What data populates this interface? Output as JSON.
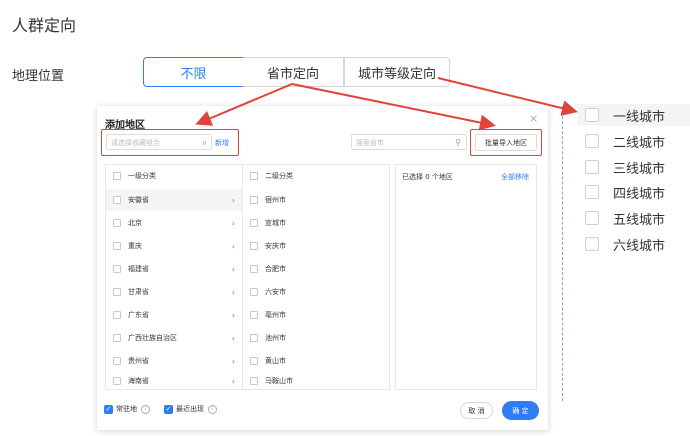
{
  "header": {
    "title": "人群定向"
  },
  "geo": {
    "label": "地理位置",
    "options": [
      "不限",
      "省市定向",
      "城市等级定向"
    ]
  },
  "modal": {
    "title": "添加地区",
    "close": "×",
    "select_placeholder": "请选择收藏组合",
    "add_link": "新增",
    "search_placeholder": "搜索省市",
    "import_button": "批量导入地区",
    "left_header": "一级分类",
    "mid_header": "二级分类",
    "right_header": "已选择 0 个地区",
    "clear_all": "全部移除",
    "provinces": [
      "安徽省",
      "北京",
      "重庆",
      "福建省",
      "甘肃省",
      "广东省",
      "广西壮族自治区",
      "贵州省",
      "海南省"
    ],
    "cities": [
      "宿州市",
      "宣城市",
      "安庆市",
      "合肥市",
      "六安市",
      "亳州市",
      "池州市",
      "黄山市",
      "马鞍山市"
    ],
    "footer": {
      "resident": "常驻地",
      "recent": "最近出现",
      "cancel": "取 消",
      "ok": "确 定"
    }
  },
  "city_levels": [
    "一线城市",
    "二线城市",
    "三线城市",
    "四线城市",
    "五线城市",
    "六线城市"
  ],
  "colors": {
    "accent": "#2f7df6",
    "annotation_red": "#e0433a"
  }
}
